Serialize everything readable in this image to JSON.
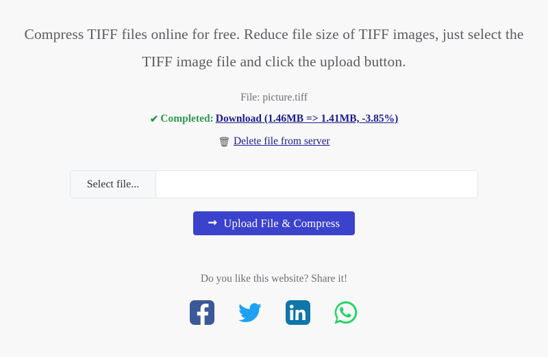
{
  "heading": {
    "text": "Compress TIFF files online for free. Reduce file size of TIFF images, just select the TIFF image file and click the upload button."
  },
  "status": {
    "file_line": "File: picture.tiff",
    "check_icon": "check-icon",
    "completed_label": "Completed:",
    "download_link": "Download (1.46MB => 1.41MB, -3.85%)",
    "trash_icon": "trash-icon",
    "delete_link": "Delete file from server",
    "completed_color": "#2e9a4f",
    "link_color": "#1b1b8f",
    "original_size": "1.46MB",
    "compressed_size": "1.41MB",
    "change_percent": "-3.85%"
  },
  "file_input": {
    "select_label": "Select file...",
    "value": "",
    "placeholder": ""
  },
  "upload": {
    "arrow_icon": "arrow-right-icon",
    "label": "Upload File & Compress",
    "color": "#3b42cc"
  },
  "share": {
    "prompt": "Do you like this website? Share it!",
    "items": [
      {
        "name": "facebook",
        "icon": "facebook-icon",
        "color": "#3b5998"
      },
      {
        "name": "twitter",
        "icon": "twitter-icon",
        "color": "#1da1f2"
      },
      {
        "name": "linkedin",
        "icon": "linkedin-icon",
        "color": "#0e76a8"
      },
      {
        "name": "whatsapp",
        "icon": "whatsapp-icon",
        "color": "#25d366"
      }
    ]
  },
  "theme": {
    "background": "#f8f8f8",
    "text": "#5b5b63"
  }
}
